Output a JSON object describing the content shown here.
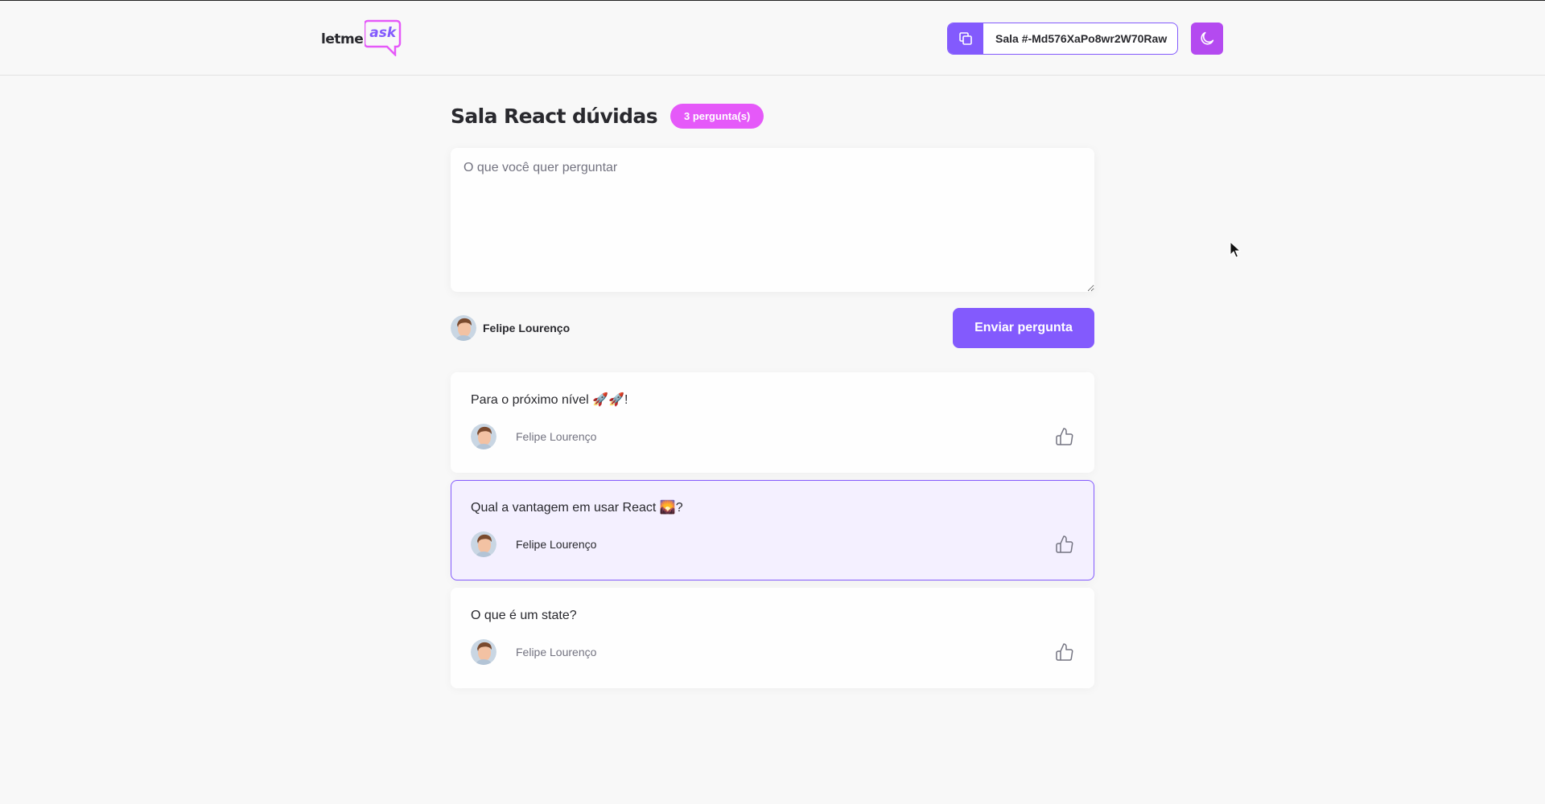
{
  "header": {
    "logo": {
      "letme": "letme",
      "ask": "ask"
    },
    "room_code": {
      "text": "Sala #-Md576XaPo8wr2W70Raw"
    }
  },
  "room": {
    "title": "Sala React dúvidas",
    "question_count": "3 pergunta(s)"
  },
  "form": {
    "placeholder": "O que você quer perguntar",
    "user_name": "Felipe Lourenço",
    "submit_label": "Enviar pergunta"
  },
  "questions": [
    {
      "content": "Para o próximo nível 🚀🚀!",
      "author": "Felipe Lourenço",
      "highlighted": false
    },
    {
      "content": "Qual a vantagem em usar React 🌄?",
      "author": "Felipe Lourenço",
      "highlighted": true
    },
    {
      "content": "O que é um state?",
      "author": "Felipe Lourenço",
      "highlighted": false
    }
  ],
  "colors": {
    "primary": "#835afd",
    "pink": "#e559f9",
    "theme_button": "#b44af0",
    "background": "#f8f8f8"
  },
  "icons": {
    "copy": "copy-icon",
    "theme": "moon-icon",
    "like": "thumbs-up-icon"
  }
}
